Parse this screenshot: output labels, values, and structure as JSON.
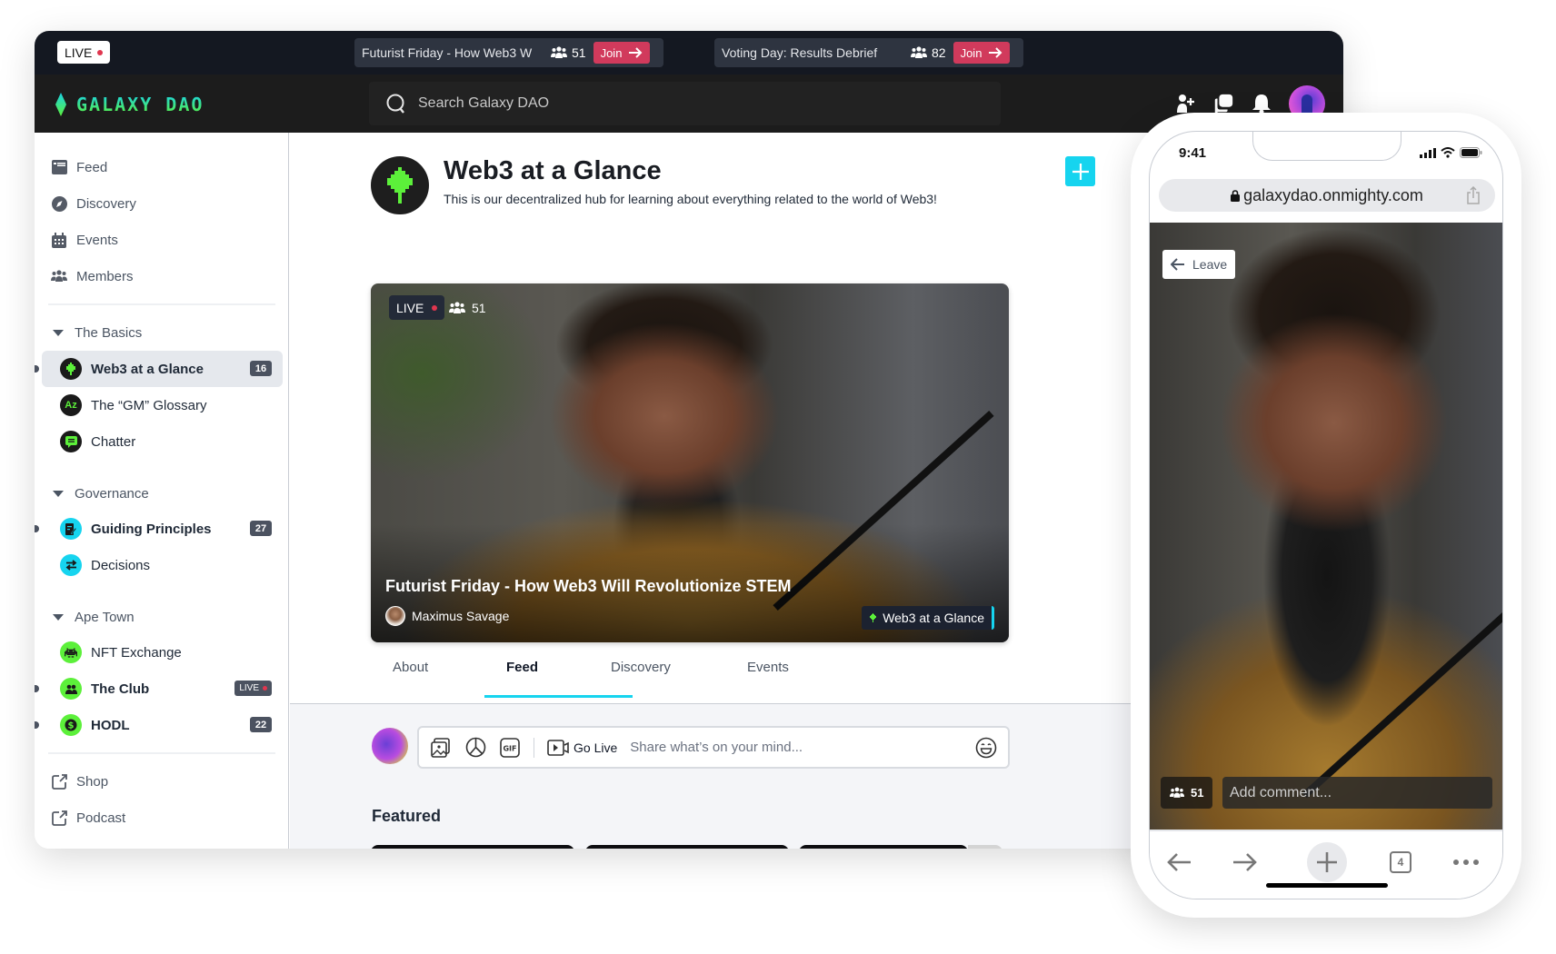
{
  "colors": {
    "accent": "#16d4ef",
    "live_red": "#e0364f",
    "join_button": "#d13a5c",
    "brand_green": "#5cf03a",
    "nav_dark": "#1c1c1c",
    "livebar_dark": "#141821"
  },
  "livebar": {
    "live_label": "LIVE",
    "events": [
      {
        "title": "Futurist Friday - How Web3 W",
        "count": "51",
        "join_label": "Join"
      },
      {
        "title": "Voting Day: Results Debrief",
        "count": "82",
        "join_label": "Join"
      }
    ]
  },
  "topnav": {
    "brand": "GALAXY DAO",
    "search_placeholder": "Search Galaxy DAO",
    "icons": [
      "add-user-icon",
      "chat-icon",
      "bell-icon",
      "user-avatar"
    ]
  },
  "sidebar": {
    "nav": [
      {
        "label": "Feed",
        "icon": "feed-icon"
      },
      {
        "label": "Discovery",
        "icon": "compass-icon"
      },
      {
        "label": "Events",
        "icon": "calendar-icon"
      },
      {
        "label": "Members",
        "icon": "members-icon"
      }
    ],
    "groups": [
      {
        "label": "The Basics",
        "channels": [
          {
            "label": "Web3 at a Glance",
            "badge": "16",
            "active": true,
            "unread": true,
            "icon": "pixel-tree-icon"
          },
          {
            "label": "The “GM” Glossary",
            "icon": "az-icon"
          },
          {
            "label": "Chatter",
            "icon": "chat-bubble-icon"
          }
        ]
      },
      {
        "label": "Governance",
        "channels": [
          {
            "label": "Guiding Principles",
            "badge": "27",
            "unread": true,
            "icon": "document-edit-icon"
          },
          {
            "label": "Decisions",
            "icon": "swap-arrows-icon"
          }
        ]
      },
      {
        "label": "Ape Town",
        "channels": [
          {
            "label": "NFT Exchange",
            "icon": "space-invader-icon"
          },
          {
            "label": "The Club",
            "badge": "LIVE",
            "unread": true,
            "icon": "people-icon"
          },
          {
            "label": "HODL",
            "badge": "22",
            "unread": true,
            "icon": "dollar-icon"
          }
        ]
      }
    ],
    "links": [
      {
        "label": "Shop",
        "icon": "external-link-icon"
      },
      {
        "label": "Podcast",
        "icon": "external-link-icon"
      }
    ]
  },
  "main": {
    "title": "Web3 at a Glance",
    "description": "This is our decentralized hub for learning about everything related to the world of Web3!",
    "hero": {
      "live_label": "LIVE",
      "viewer_count": "51",
      "title": "Futurist Friday - How Web3 Will Revolutionize STEM",
      "author": "Maximus Savage",
      "channel_tag": "Web3 at a Glance"
    },
    "tabs": [
      {
        "label": "About"
      },
      {
        "label": "Feed",
        "active": true
      },
      {
        "label": "Discovery"
      },
      {
        "label": "Events"
      }
    ],
    "composer": {
      "go_live_label": "Go Live",
      "placeholder": "Share what’s on your mind..."
    },
    "featured_heading": "Featured"
  },
  "phone": {
    "time": "9:41",
    "url": "galaxydao.onmighty.com",
    "leave_label": "Leave",
    "viewer_count": "51",
    "comment_placeholder": "Add comment...",
    "tab_count": "4"
  }
}
